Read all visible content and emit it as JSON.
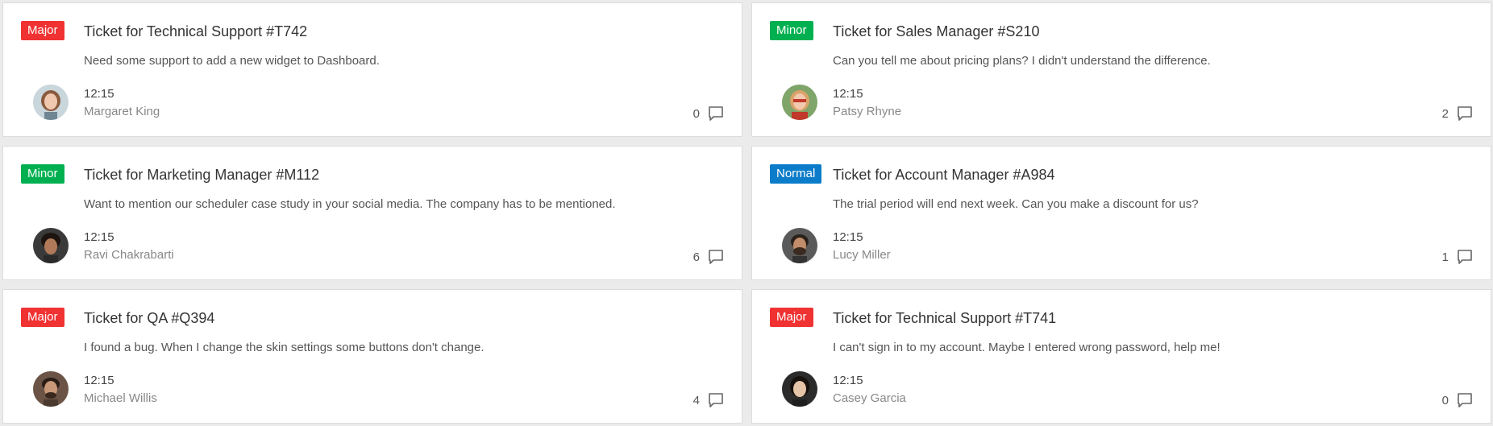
{
  "colors": {
    "major": "#f03232",
    "minor": "#00b050",
    "normal": "#0a7cc9",
    "card_border": "#dcdcdc",
    "background": "#ebebeb"
  },
  "tickets": [
    {
      "priority": "Major",
      "title": "Ticket for Technical Support #T742",
      "description": "Need some support to add a new widget to Dashboard.",
      "time": "12:15",
      "author": "Margaret King",
      "comments": "0"
    },
    {
      "priority": "Minor",
      "title": "Ticket for Sales Manager #S210",
      "description": "Can you tell me about pricing plans? I didn't understand the difference.",
      "time": "12:15",
      "author": "Patsy Rhyne",
      "comments": "2"
    },
    {
      "priority": "Minor",
      "title": "Ticket for Marketing Manager #M112",
      "description": "Want to mention our scheduler case study in your social media. The company has to be mentioned.",
      "time": "12:15",
      "author": "Ravi Chakrabarti",
      "comments": "6"
    },
    {
      "priority": "Normal",
      "title": "Ticket for Account Manager #A984",
      "description": "The trial period will end next week. Can you make a discount for us?",
      "time": "12:15",
      "author": "Lucy Miller",
      "comments": "1"
    },
    {
      "priority": "Major",
      "title": "Ticket for QA #Q394",
      "description": "I found a bug. When I change the skin settings some buttons don't change.",
      "time": "12:15",
      "author": "Michael Willis",
      "comments": "4"
    },
    {
      "priority": "Major",
      "title": "Ticket for Technical Support #T741",
      "description": "I can't sign in to my account. Maybe I entered wrong password, help me!",
      "time": "12:15",
      "author": "Casey Garcia",
      "comments": "0"
    }
  ]
}
